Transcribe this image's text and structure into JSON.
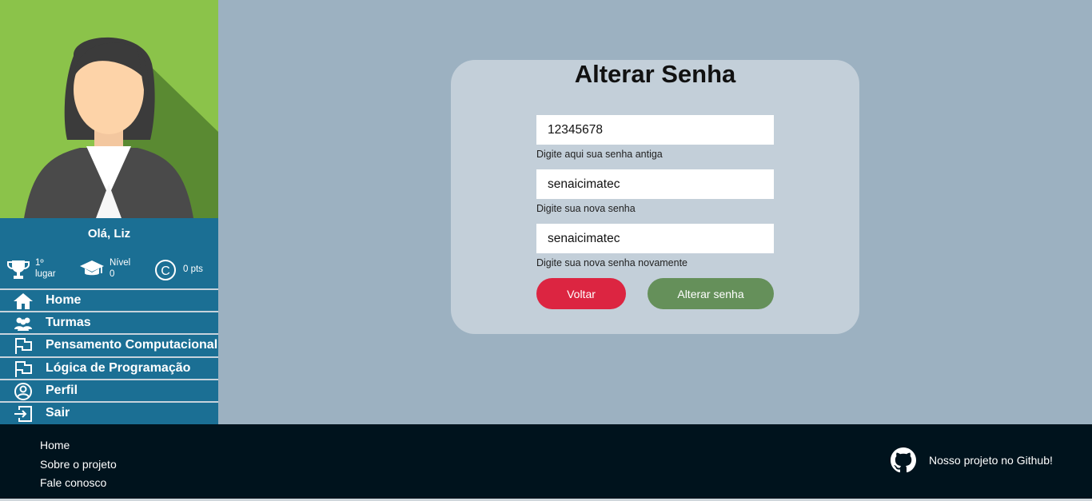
{
  "user": {
    "greeting": "Olá, Liz",
    "rank_value": "1º",
    "rank_label": "lugar",
    "level_label": "Nível",
    "level_value": "0",
    "points": "0 pts"
  },
  "nav": {
    "items": [
      {
        "label": "Home",
        "icon": "home-icon"
      },
      {
        "label": "Turmas",
        "icon": "users-icon"
      },
      {
        "label": "Pensamento Computacional",
        "icon": "flag-icon"
      },
      {
        "label": "Lógica de Programação",
        "icon": "flag-icon"
      },
      {
        "label": "Perfil",
        "icon": "user-circle-icon"
      },
      {
        "label": "Sair",
        "icon": "logout-icon"
      }
    ]
  },
  "form": {
    "title": "Alterar Senha",
    "old_password": {
      "value": "12345678",
      "hint": "Digite aqui sua senha antiga"
    },
    "new_password": {
      "value": "senaicimatec",
      "hint": "Digite sua nova senha"
    },
    "confirm_password": {
      "value": "senaicimatec",
      "hint": "Digite sua nova senha novamente"
    },
    "back_label": "Voltar",
    "submit_label": "Alterar senha"
  },
  "footer": {
    "links": [
      "Home",
      "Sobre o projeto",
      "Fale conosco"
    ],
    "github_label": "Nosso projeto no Github!"
  },
  "colors": {
    "sidebar": "#1b6f94",
    "background": "#9cb1c1",
    "card": "#c3cfd9",
    "back_button": "#dc2541",
    "submit_button": "#65905a",
    "footer": "#00131d",
    "avatar_bg": "#8ac24f"
  }
}
